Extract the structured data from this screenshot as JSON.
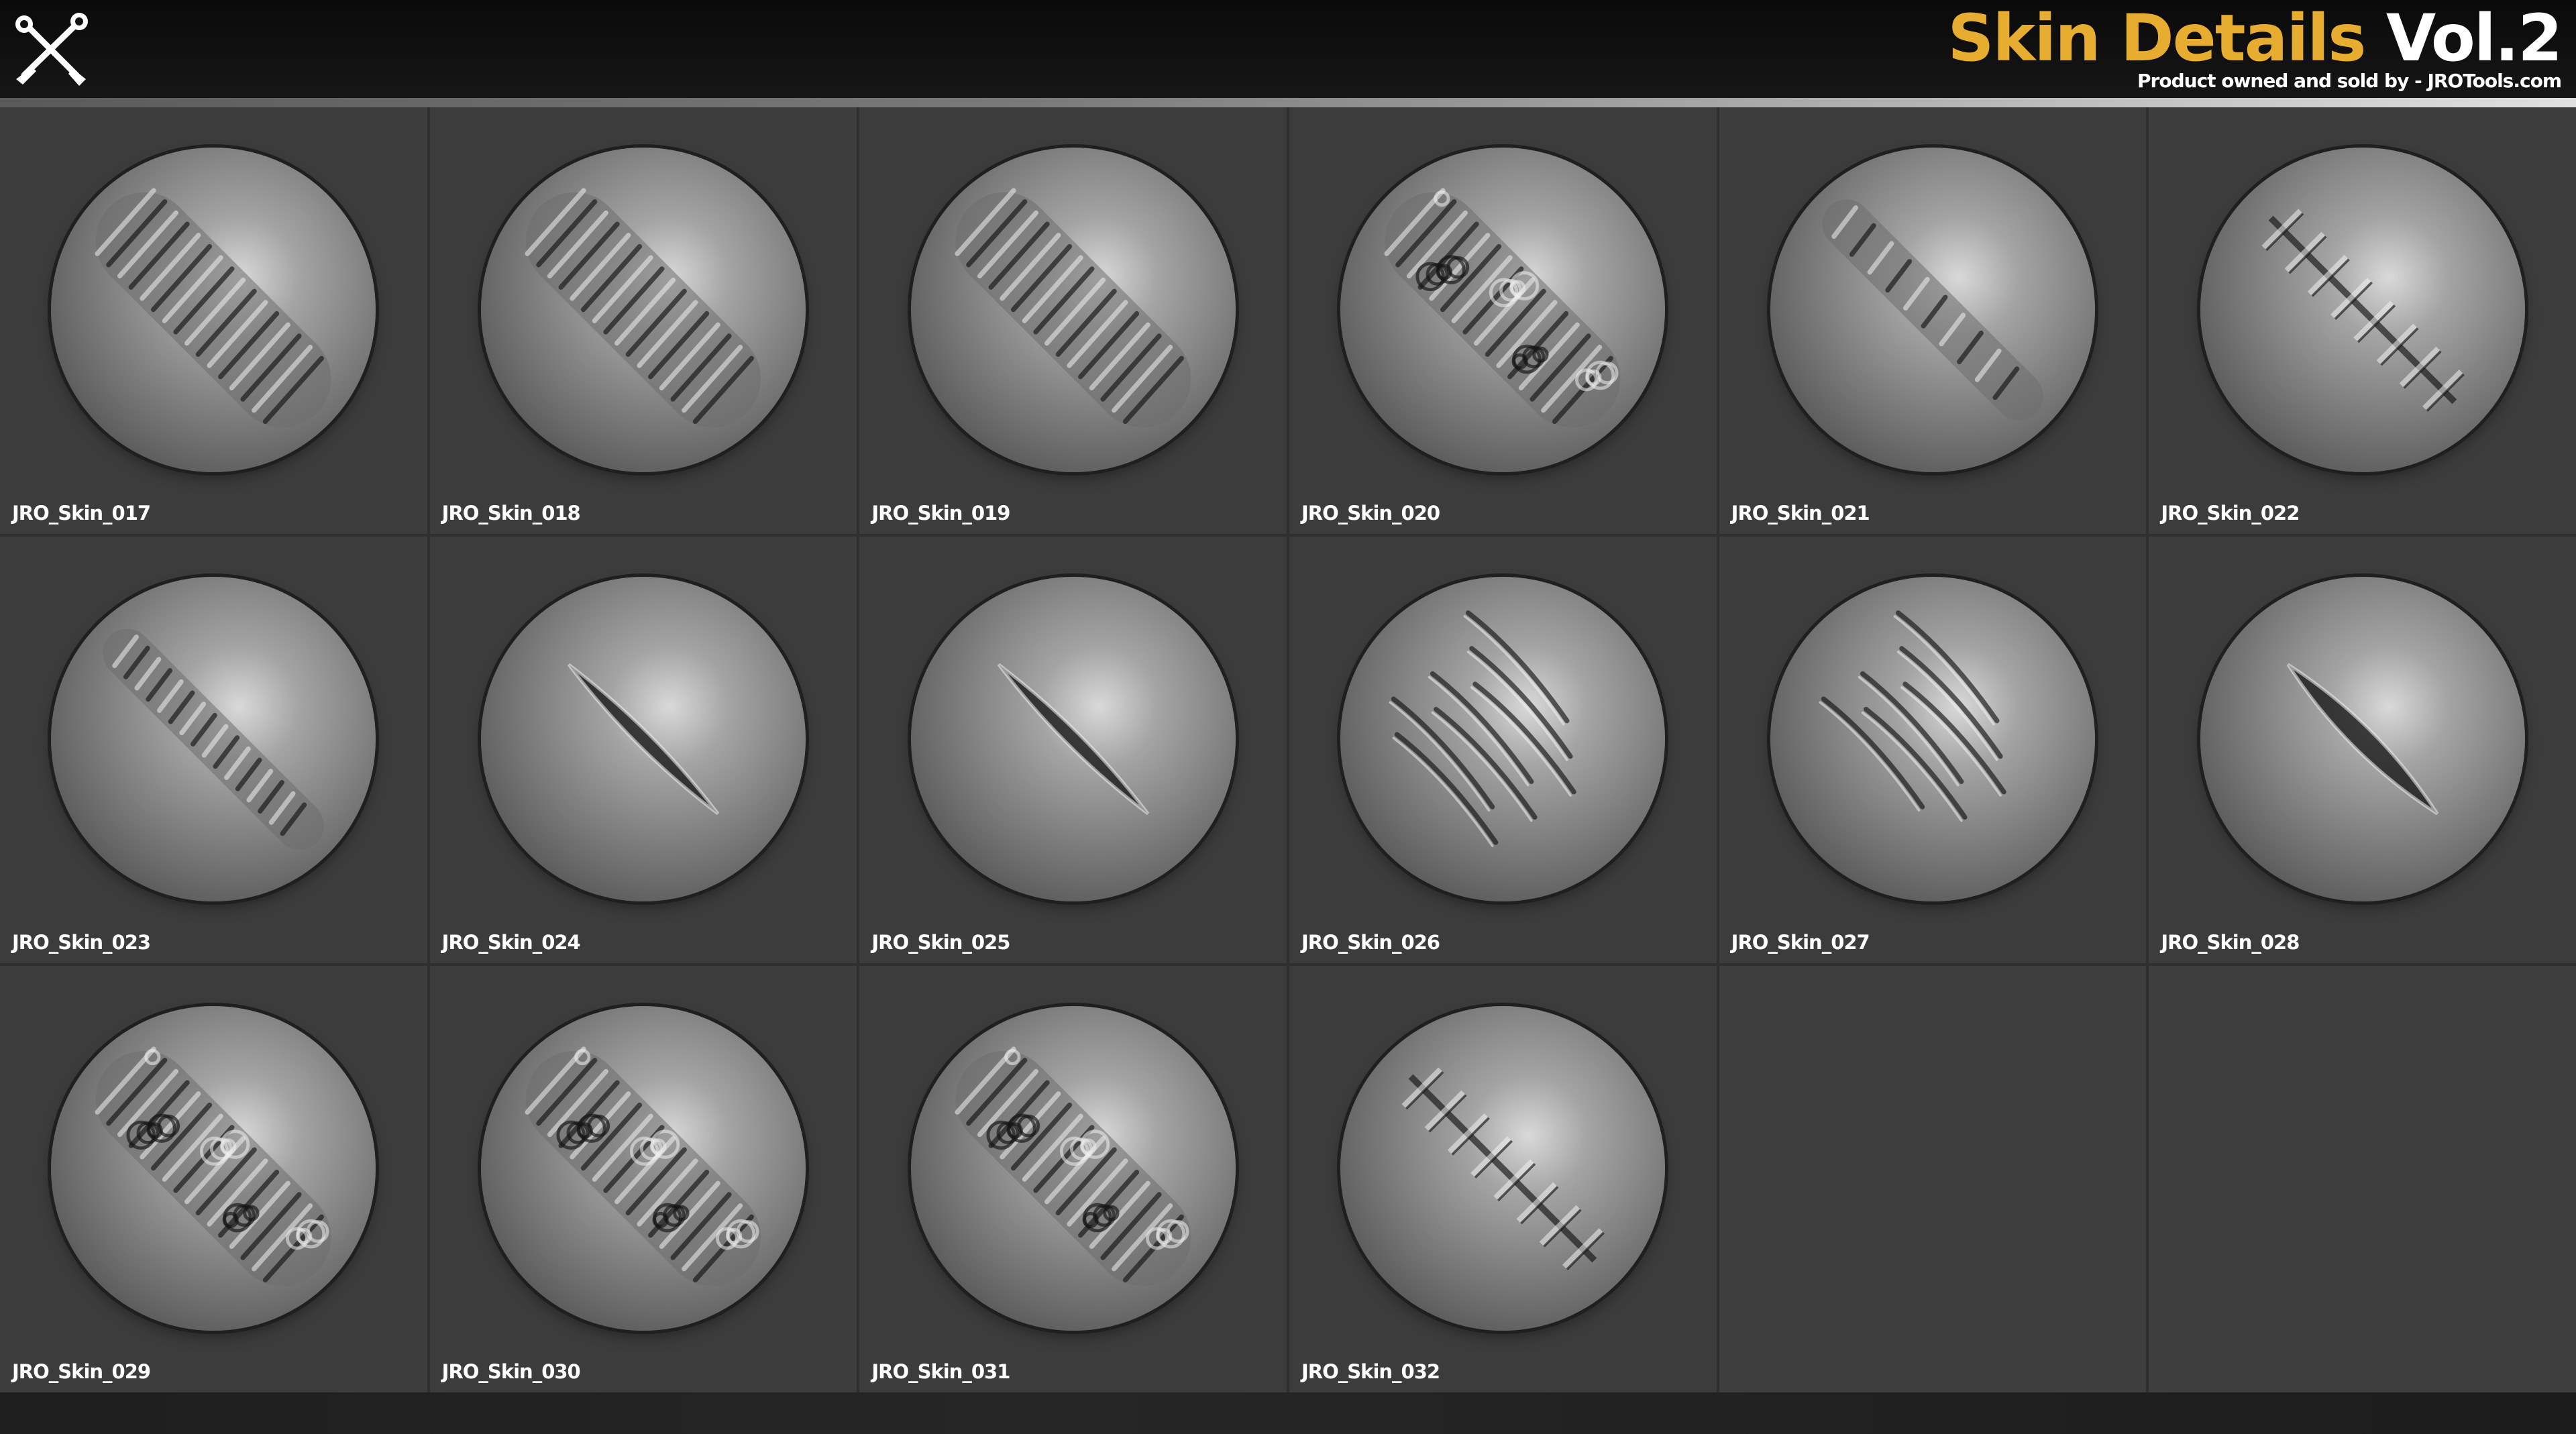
{
  "header": {
    "title_accent": "Skin Details",
    "title_vol": "Vol.2",
    "subtitle": "Product owned and sold by - JROTools.com",
    "logo_icon": "crossed-tools-icon"
  },
  "colors": {
    "accent": "#e7ad31",
    "header_bg": "#0f0f0f",
    "tile_bg": "#3c3c3c"
  },
  "brushes": [
    {
      "label": "JRO_Skin_017",
      "detail": "wrinkle-fold"
    },
    {
      "label": "JRO_Skin_018",
      "detail": "ribbed-fold"
    },
    {
      "label": "JRO_Skin_019",
      "detail": "smooth-fold"
    },
    {
      "label": "JRO_Skin_020",
      "detail": "cluster-wrinkles"
    },
    {
      "label": "JRO_Skin_021",
      "detail": "segmented-ridge"
    },
    {
      "label": "JRO_Skin_022",
      "detail": "stitched-scar"
    },
    {
      "label": "JRO_Skin_023",
      "detail": "bumpy-strip"
    },
    {
      "label": "JRO_Skin_024",
      "detail": "thin-cut"
    },
    {
      "label": "JRO_Skin_025",
      "detail": "deep-cut"
    },
    {
      "label": "JRO_Skin_026",
      "detail": "multi-scratches"
    },
    {
      "label": "JRO_Skin_027",
      "detail": "long-scratches"
    },
    {
      "label": "JRO_Skin_028",
      "detail": "torn-wound"
    },
    {
      "label": "JRO_Skin_029",
      "detail": "blister-bumps"
    },
    {
      "label": "JRO_Skin_030",
      "detail": "pitted-skin"
    },
    {
      "label": "JRO_Skin_031",
      "detail": "cracked-texture"
    },
    {
      "label": "JRO_Skin_032",
      "detail": "staple-stitches"
    }
  ]
}
